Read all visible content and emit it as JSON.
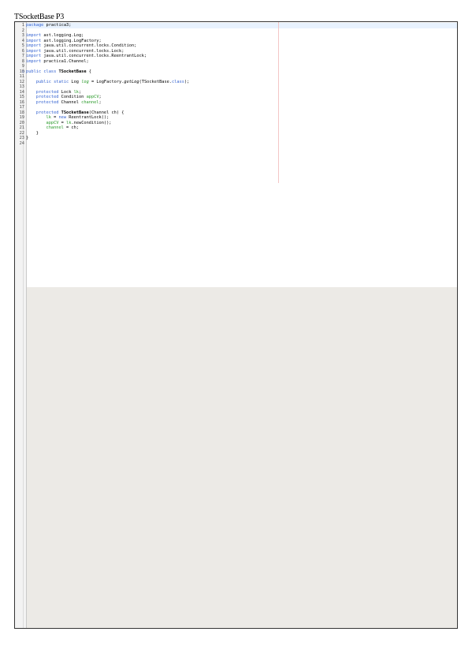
{
  "document": {
    "title": "TSocketBase P3"
  },
  "editor": {
    "lines": [
      {
        "n": "1",
        "tokens": [
          {
            "t": "package",
            "c": "kw"
          },
          {
            "t": " practica3;"
          }
        ]
      },
      {
        "n": "2",
        "tokens": []
      },
      {
        "n": "3",
        "tokens": [
          {
            "t": "import",
            "c": "kw"
          },
          {
            "t": " ast.logging.Log;"
          }
        ]
      },
      {
        "n": "4",
        "tokens": [
          {
            "t": "import",
            "c": "kw"
          },
          {
            "t": " ast.logging.LogFactory;"
          }
        ]
      },
      {
        "n": "5",
        "tokens": [
          {
            "t": "import",
            "c": "kw"
          },
          {
            "t": " java.util.concurrent.locks.Condition;"
          }
        ]
      },
      {
        "n": "6",
        "tokens": [
          {
            "t": "import",
            "c": "kw"
          },
          {
            "t": " java.util.concurrent.locks.Lock;"
          }
        ]
      },
      {
        "n": "7",
        "tokens": [
          {
            "t": "import",
            "c": "kw"
          },
          {
            "t": " java.util.concurrent.locks.ReentrantLock;"
          }
        ]
      },
      {
        "n": "8",
        "tokens": [
          {
            "t": "import",
            "c": "kw"
          },
          {
            "t": " practica1.Channel;"
          }
        ]
      },
      {
        "n": "9",
        "tokens": []
      },
      {
        "n": "10",
        "marker": true,
        "tokens": [
          {
            "t": "public class",
            "c": "kw"
          },
          {
            "t": " "
          },
          {
            "t": "TSocketBase",
            "c": "bold"
          },
          {
            "t": " {"
          }
        ]
      },
      {
        "n": "11",
        "tokens": []
      },
      {
        "n": "12",
        "tokens": [
          {
            "t": "    "
          },
          {
            "t": "public static",
            "c": "kw"
          },
          {
            "t": " Log "
          },
          {
            "t": "log",
            "c": "var it"
          },
          {
            "t": " = LogFactory."
          },
          {
            "t": "getLog",
            "c": "it"
          },
          {
            "t": "(TSocketBase."
          },
          {
            "t": "class",
            "c": "kw"
          },
          {
            "t": ");"
          }
        ]
      },
      {
        "n": "13",
        "tokens": []
      },
      {
        "n": "14",
        "tokens": [
          {
            "t": "    "
          },
          {
            "t": "protected",
            "c": "kw"
          },
          {
            "t": " Lock "
          },
          {
            "t": "lk",
            "c": "var"
          },
          {
            "t": ";"
          }
        ]
      },
      {
        "n": "15",
        "tokens": [
          {
            "t": "    "
          },
          {
            "t": "protected",
            "c": "kw"
          },
          {
            "t": " Condition "
          },
          {
            "t": "appCV",
            "c": "var"
          },
          {
            "t": ";"
          }
        ]
      },
      {
        "n": "16",
        "tokens": [
          {
            "t": "    "
          },
          {
            "t": "protected",
            "c": "kw"
          },
          {
            "t": " Channel "
          },
          {
            "t": "channel",
            "c": "var"
          },
          {
            "t": ";"
          }
        ]
      },
      {
        "n": "17",
        "tokens": []
      },
      {
        "n": "18",
        "tokens": [
          {
            "t": "    "
          },
          {
            "t": "protected",
            "c": "kw"
          },
          {
            "t": " "
          },
          {
            "t": "TSocketBase",
            "c": "bold"
          },
          {
            "t": "(Channel ch) {"
          }
        ]
      },
      {
        "n": "19",
        "tokens": [
          {
            "t": "        "
          },
          {
            "t": "lk",
            "c": "var"
          },
          {
            "t": " = "
          },
          {
            "t": "new",
            "c": "kw"
          },
          {
            "t": " ReentrantLock();"
          }
        ]
      },
      {
        "n": "20",
        "tokens": [
          {
            "t": "        "
          },
          {
            "t": "appCV",
            "c": "var"
          },
          {
            "t": " = "
          },
          {
            "t": "lk",
            "c": "var"
          },
          {
            "t": ".newCondition();"
          }
        ]
      },
      {
        "n": "21",
        "tokens": [
          {
            "t": "        "
          },
          {
            "t": "channel",
            "c": "var"
          },
          {
            "t": " = ch;"
          }
        ]
      },
      {
        "n": "22",
        "tokens": [
          {
            "t": "    }"
          }
        ]
      },
      {
        "n": "23",
        "tokens": [
          {
            "t": "}"
          }
        ]
      },
      {
        "n": "24",
        "tokens": []
      }
    ]
  },
  "colors": {
    "keyword": "#2f5fd0",
    "field": "#2a9a2a",
    "current_line": "#e8f2fe",
    "empty_area": "#eceae6",
    "print_margin": "#f4c6c6"
  }
}
